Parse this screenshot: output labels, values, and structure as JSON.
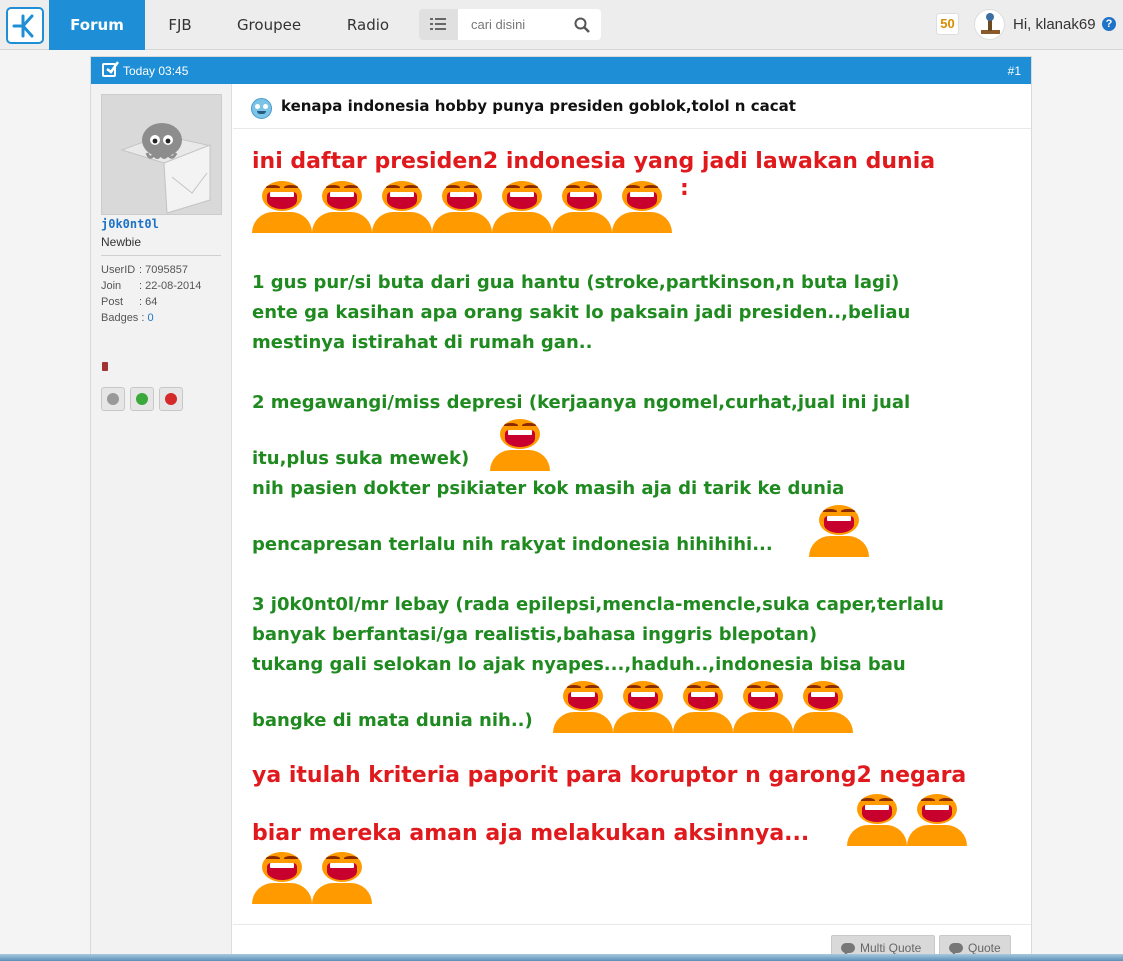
{
  "nav": {
    "tabs": [
      {
        "label": "Forum",
        "active": true
      },
      {
        "label": "FJB"
      },
      {
        "label": "Groupee"
      },
      {
        "label": "Radio"
      }
    ],
    "search_placeholder": "cari disini",
    "notification_count": "50",
    "greeting": "Hi, klanak69",
    "help": "?"
  },
  "post": {
    "time": "Today 03:45",
    "number": "#1",
    "title": "kenapa indonesia hobby punya presiden goblok,tolol n cacat"
  },
  "poster": {
    "name": "j0k0nt0l",
    "rank": "Newbie",
    "stats": [
      {
        "key": "UserID",
        "value": ": 7095857"
      },
      {
        "key": "Join",
        "value": ": 22-08-2014"
      },
      {
        "key": "Post",
        "value": ": 64"
      },
      {
        "key": "Badges",
        "value": "0"
      }
    ]
  },
  "body": {
    "lines": [
      {
        "text": "ini daftar presiden2 indonesia yang jadi lawakan dunia",
        "style": "red"
      },
      {
        "text": ":",
        "style": "red"
      },
      {
        "text": "1 gus pur/si buta dari gua hantu (stroke,partkinson,n buta lagi)",
        "style": "green"
      },
      {
        "text": "ente ga kasihan apa orang sakit lo paksain jadi presiden..,beliau",
        "style": "green"
      },
      {
        "text": "mestinya istirahat di rumah gan..",
        "style": "green"
      },
      {
        "text": "2 megawangi/miss depresi (kerjaanya ngomel,curhat,jual ini jual",
        "style": "green"
      },
      {
        "text": "itu,plus suka mewek)",
        "style": "green"
      },
      {
        "text": "nih pasien dokter psikiater kok masih aja di tarik ke dunia",
        "style": "green"
      },
      {
        "text": "pencapresan terlalu nih rakyat indonesia hihihihi...",
        "style": "green"
      },
      {
        "text": "3 j0k0nt0l/mr lebay (rada epilepsi,mencla-mencle,suka caper,terlalu",
        "style": "green"
      },
      {
        "text": "banyak berfantasi/ga realistis,bahasa inggris blepotan)",
        "style": "green"
      },
      {
        "text": "tukang gali selokan lo ajak nyapes...,haduh..,indonesia bisa bau",
        "style": "green"
      },
      {
        "text": "bangke di mata dunia nih..)",
        "style": "green"
      },
      {
        "text": "ya itulah kriteria paporit para koruptor n garong2 negara",
        "style": "red"
      },
      {
        "text": "biar mereka aman aja melakukan aksinnya...",
        "style": "red"
      }
    ]
  },
  "footer": {
    "multi_quote": "Multi Quote",
    "quote": "Quote"
  },
  "colors": {
    "accent": "#1e8fd6",
    "red_text": "#e0191d",
    "green_text": "#1f8a1f",
    "emoticon": "#ff9a00"
  },
  "icons": [
    "kaskus-logo-icon",
    "list-icon",
    "search-icon",
    "help-icon",
    "check-icon",
    "laugh-emoticon-icon",
    "speech-bubble-icon"
  ]
}
